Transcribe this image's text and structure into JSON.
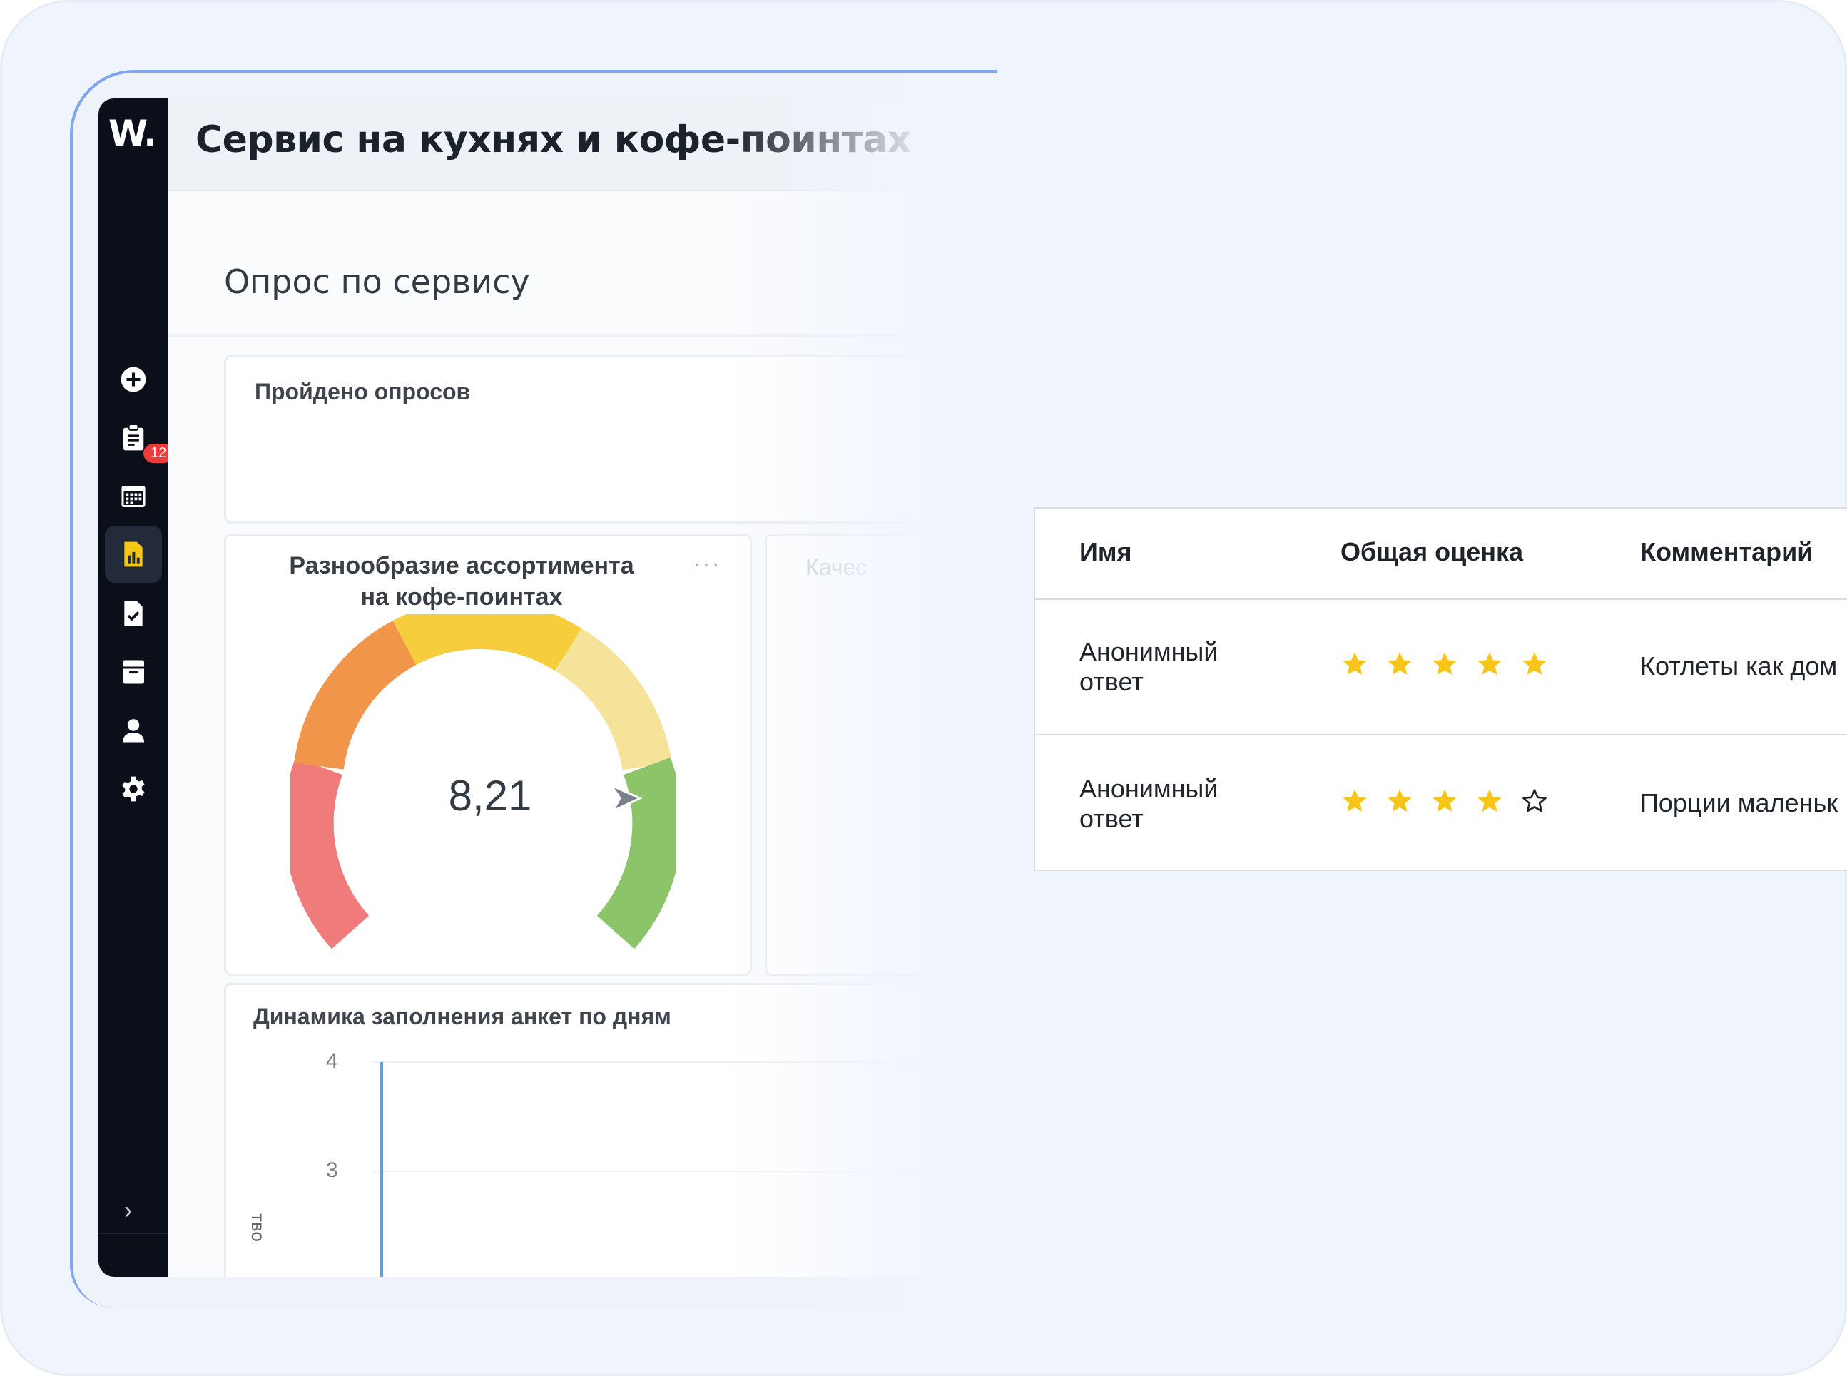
{
  "app": {
    "logo": "W.",
    "page_title": "Сервис на кухнях и кофе-поинтах"
  },
  "sidebar": {
    "items": [
      {
        "name": "add",
        "icon": "plus-circle-icon"
      },
      {
        "name": "tasks",
        "icon": "clipboard-icon",
        "badge": "12"
      },
      {
        "name": "calendar",
        "icon": "calendar-icon"
      },
      {
        "name": "reports",
        "icon": "report-chart-icon",
        "active": true
      },
      {
        "name": "documents",
        "icon": "document-check-icon"
      },
      {
        "name": "archive",
        "icon": "archive-icon"
      },
      {
        "name": "users",
        "icon": "user-icon"
      },
      {
        "name": "settings",
        "icon": "gear-icon"
      }
    ],
    "expand": "›"
  },
  "survey": {
    "title": "Опрос по сервису",
    "completed_card_title": "Пройдено опросов",
    "gauge_card": {
      "title_line1": "Разнообразие ассортимента",
      "title_line2": "на кофе-поинтах",
      "value": "8,21",
      "menu": "···",
      "colors": [
        "#ef7b7b",
        "#f0954a",
        "#f5cd3d",
        "#f6e39a",
        "#8cc46a"
      ]
    },
    "faded_card_label": "Качес",
    "dynamics_card": {
      "title": "Динамика заполнения анкет по дням",
      "y_ticks": [
        "4",
        "3"
      ],
      "y_axis_label_fragment": "тво"
    }
  },
  "reviews_table": {
    "headers": {
      "name": "Имя",
      "rating": "Общая оценка",
      "comment": "Комментарий"
    },
    "rows": [
      {
        "name_line1": "Анонимный",
        "name_line2": "ответ",
        "stars": 5,
        "comment": "Котлеты как дом"
      },
      {
        "name_line1": "Анонимный",
        "name_line2": "ответ",
        "stars": 4,
        "comment": "Порции маленьк"
      }
    ],
    "star_color": "#f7c519"
  }
}
